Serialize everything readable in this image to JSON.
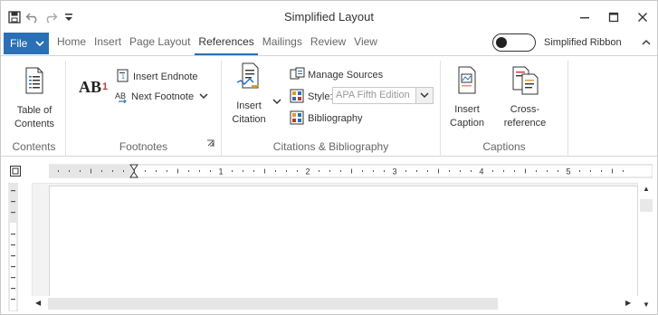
{
  "window": {
    "title": "Simplified Layout"
  },
  "quick_access": {
    "icons": [
      "save-icon",
      "undo-icon",
      "redo-icon",
      "customize-dropdown-icon"
    ]
  },
  "window_controls": [
    "minimize-icon",
    "maximize-icon",
    "close-icon"
  ],
  "tabs": {
    "file_label": "File",
    "items": [
      "Home",
      "Insert",
      "Page Layout",
      "References",
      "Mailings",
      "Review",
      "View"
    ],
    "active": "References"
  },
  "simplified_ribbon": {
    "label": "Simplified Ribbon",
    "enabled": false
  },
  "ribbon": {
    "contents": {
      "group_label": "Contents",
      "toc_line1": "Table of",
      "toc_line2": "Contents"
    },
    "footnotes": {
      "group_label": "Footnotes",
      "insert_footnote_glyph": "AB",
      "insert_footnote_sup": "1",
      "insert_endnote": "Insert Endnote",
      "next_footnote": "Next Footnote"
    },
    "citations": {
      "group_label": "Citations & Bibliography",
      "insert_citation_line1": "Insert",
      "insert_citation_line2": "Citation",
      "manage_sources": "Manage Sources",
      "style_label": "Style:",
      "style_value": "APA Fifth Edition",
      "bibliography": "Bibliography"
    },
    "captions": {
      "group_label": "Captions",
      "insert_caption_line1": "Insert",
      "insert_caption_line2": "Caption",
      "cross_reference": "Cross-reference"
    }
  },
  "ruler": {
    "numbers": [
      "1",
      "2",
      "3",
      "4",
      "5"
    ]
  },
  "colors": {
    "accent": "#2b6fb6",
    "text": "#333333",
    "muted": "#666666"
  }
}
